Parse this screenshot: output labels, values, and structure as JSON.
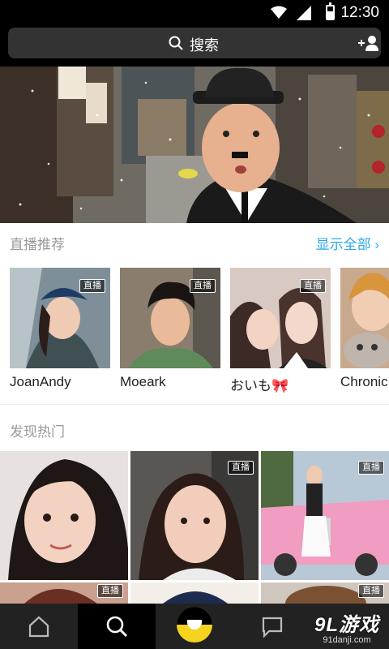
{
  "status_bar": {
    "time": "12:30"
  },
  "search": {
    "label": "搜索",
    "icon": "search-icon",
    "add_icon": "add-friend-icon"
  },
  "live": {
    "title": "直播推荐",
    "show_all": "显示全部 ›",
    "items": [
      {
        "name": "JoanAndy",
        "badge": "直播"
      },
      {
        "name": "Moeark",
        "badge": "直播"
      },
      {
        "name": "おいも🎀",
        "badge": "直播"
      },
      {
        "name": "Chronic",
        "badge": ""
      }
    ]
  },
  "hot": {
    "title": "发现热门",
    "badges": [
      "直播",
      "直播",
      "直播",
      "直播"
    ]
  },
  "nav": {
    "items": [
      "home-icon",
      "search-icon",
      "camera-eye-icon",
      "message-icon"
    ]
  },
  "watermark": {
    "main": "9L游戏",
    "sub": "91danji.com"
  },
  "colors": {
    "accent": "#2aa8e8",
    "brand_yellow": "#f5d31f",
    "dark": "#000000"
  }
}
